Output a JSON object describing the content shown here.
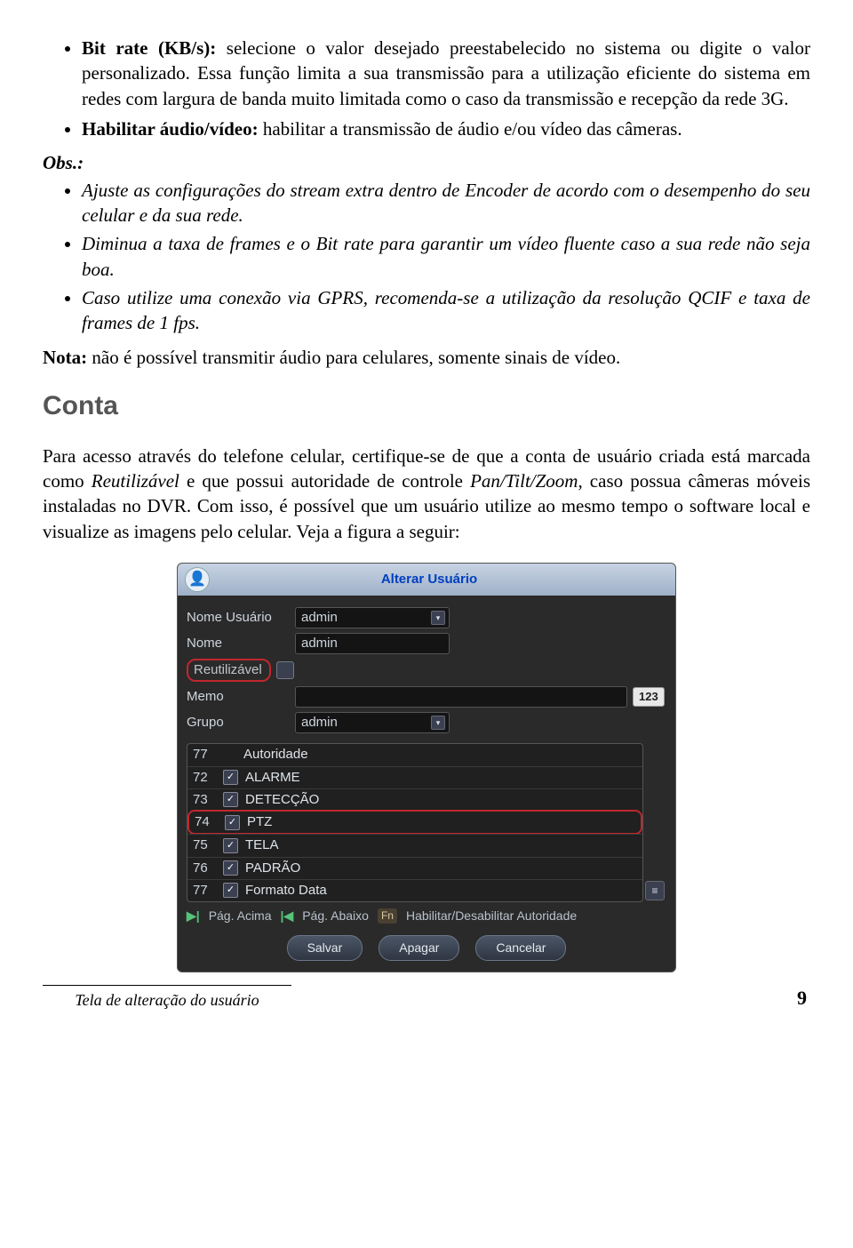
{
  "bullets1": [
    {
      "label": "Bit rate (KB/s):",
      "text": " selecione o valor desejado preestabelecido no sistema ou digite o valor personalizado. Essa função limita a sua transmissão para a utilização eficiente do sistema em redes com largura de banda muito limitada como o caso da transmissão e recepção da rede 3G."
    },
    {
      "label": "Habilitar áudio/vídeo:",
      "text": " habilitar a transmissão de áudio e/ou vídeo das câmeras."
    }
  ],
  "obs_label": "Obs.:",
  "obs_items": [
    "Ajuste as configurações do stream extra dentro de Encoder de acordo com o desempenho do seu celular e da sua rede.",
    "Diminua a taxa de frames e o Bit rate para garantir um vídeo fluente caso a sua rede não seja boa.",
    "Caso utilize uma conexão via GPRS, recomenda-se a utilização da resolução QCIF e taxa de frames de 1 fps."
  ],
  "nota_label": "Nota:",
  "nota_text": " não é possível transmitir áudio para celulares, somente sinais de vídeo.",
  "conta_head": "Conta",
  "conta_body_a": "Para acesso através do telefone celular, certifique-se de que a conta de usuário criada está marcada como ",
  "conta_body_reu": "Reutilizável",
  "conta_body_b": " e que possui autoridade de controle ",
  "conta_body_ptz": "Pan/Tilt/Zoom",
  "conta_body_c": ", caso possua câmeras móveis instaladas no DVR. Com isso, é possível que um usuário utilize ao mesmo tempo o software local e visualize as imagens pelo celular. Veja a figura a seguir:",
  "dialog": {
    "title": "Alterar Usuário",
    "icon": "👤",
    "lbl_user": "Nome Usuário",
    "lbl_name": "Nome",
    "lbl_reu": "Reutilizável",
    "lbl_memo": "Memo",
    "lbl_group": "Grupo",
    "val_user": "admin",
    "val_name": "admin",
    "val_group": "admin",
    "num_badge": "123",
    "authorities": [
      {
        "n": "77",
        "chk": false,
        "label": "Autoridade",
        "hl": false
      },
      {
        "n": "72",
        "chk": true,
        "label": "ALARME",
        "hl": false
      },
      {
        "n": "73",
        "chk": true,
        "label": "DETECÇÃO",
        "hl": false
      },
      {
        "n": "74",
        "chk": true,
        "label": "PTZ",
        "hl": true
      },
      {
        "n": "75",
        "chk": true,
        "label": "TELA",
        "hl": false
      },
      {
        "n": "76",
        "chk": true,
        "label": "PADRÃO",
        "hl": false
      },
      {
        "n": "77",
        "chk": true,
        "label": "Formato Data",
        "hl": false
      }
    ],
    "nav_up": "Pág. Acima",
    "nav_down": "Pág. Abaixo",
    "nav_fn": "Fn",
    "nav_toggle": "Habilitar/Desabilitar Autoridade",
    "btn_save": "Salvar",
    "btn_del": "Apagar",
    "btn_cancel": "Cancelar"
  },
  "caption": "Tela de alteração do usuário",
  "page_number": "9"
}
